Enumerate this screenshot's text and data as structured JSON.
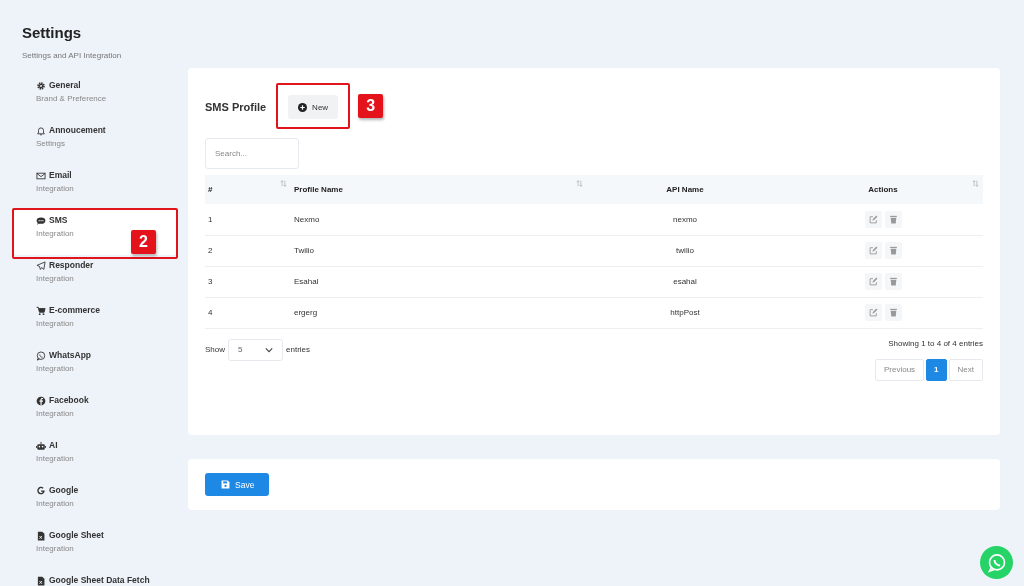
{
  "page": {
    "title": "Settings",
    "subtitle": "Settings and API Integration"
  },
  "sidebar": {
    "items": [
      {
        "label": "General",
        "sub": "Brand & Preference",
        "selected": false
      },
      {
        "label": "Annoucement",
        "sub": "Settings",
        "selected": false
      },
      {
        "label": "Email",
        "sub": "Integration",
        "selected": false
      },
      {
        "label": "SMS",
        "sub": "Integration",
        "selected": true,
        "annotation": "2"
      },
      {
        "label": "Responder",
        "sub": "Integration",
        "selected": false
      },
      {
        "label": "E-commerce",
        "sub": "Integration",
        "selected": false
      },
      {
        "label": "WhatsApp",
        "sub": "Integration",
        "selected": false
      },
      {
        "label": "Facebook",
        "sub": "Integration",
        "selected": false
      },
      {
        "label": "AI",
        "sub": "Integration",
        "selected": false
      },
      {
        "label": "Google",
        "sub": "Integration",
        "selected": false
      },
      {
        "label": "Google Sheet",
        "sub": "Integration",
        "selected": false
      },
      {
        "label": "Google Sheet Data Fetch",
        "selected": false
      }
    ]
  },
  "profile": {
    "title": "SMS Profile",
    "new_button": {
      "label": "New",
      "annotation": "3"
    },
    "search": {
      "placeholder": "Search..."
    },
    "table": {
      "columns": [
        {
          "label": "#",
          "sortable": true
        },
        {
          "label": "Profile Name",
          "sortable": true
        },
        {
          "label": "API Name",
          "sortable": false
        },
        {
          "label": "Actions",
          "sortable": true
        }
      ],
      "rows": [
        {
          "index": "1",
          "profile_name": "Nexmo",
          "api_name": "nexmo"
        },
        {
          "index": "2",
          "profile_name": "Twilio",
          "api_name": "twilio"
        },
        {
          "index": "3",
          "profile_name": "Esahal",
          "api_name": "esahal"
        },
        {
          "index": "4",
          "profile_name": "ergerg",
          "api_name": "httpPost"
        }
      ]
    },
    "length": {
      "before": "Show",
      "value": "5",
      "after": "entries"
    },
    "info": "Showing 1 to 4 of 4 entries",
    "pagination": [
      {
        "label": "Previous",
        "kind": "nav",
        "selected": false
      },
      {
        "label": "1",
        "kind": "page",
        "selected": true
      },
      {
        "label": "Next",
        "kind": "nav",
        "selected": false
      }
    ]
  },
  "save_button": {
    "label": "Save"
  }
}
